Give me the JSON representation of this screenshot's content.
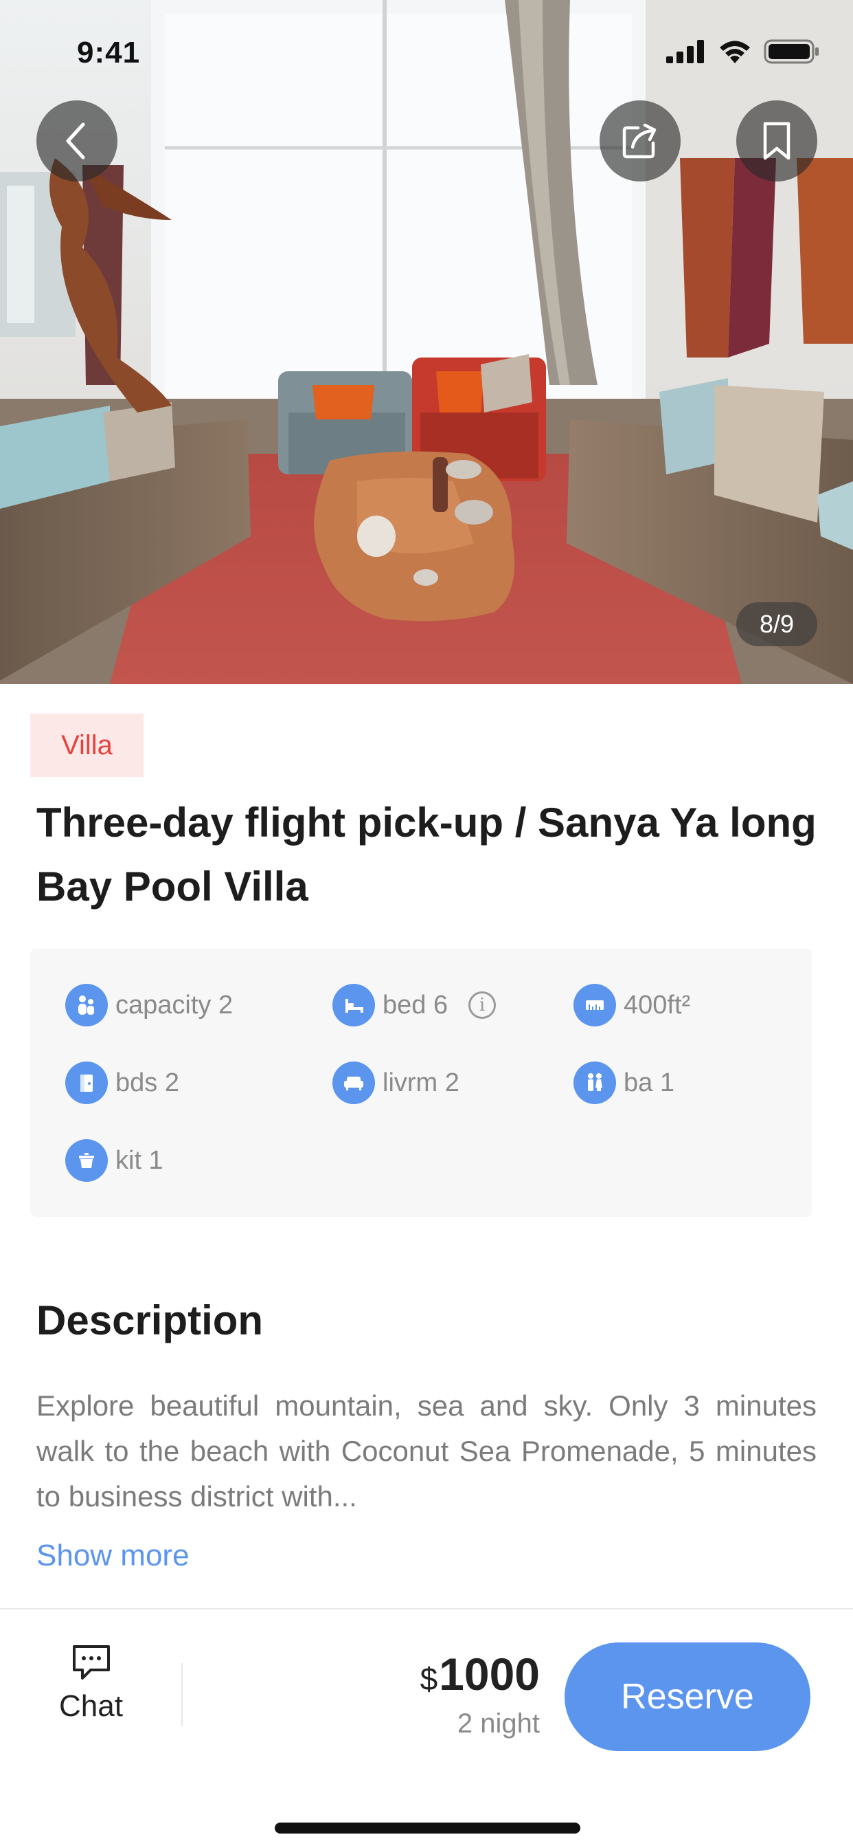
{
  "status_bar": {
    "time": "9:41"
  },
  "hero": {
    "photo_counter": "8/9",
    "icons": {
      "back": "chevron-left-icon",
      "share": "share-icon",
      "bookmark": "bookmark-icon"
    }
  },
  "listing": {
    "tag": "Villa",
    "title": "Three-day flight pick-up / Sanya Ya long Bay Pool Villa",
    "features": [
      {
        "icon": "people-icon",
        "label": "capacity 2"
      },
      {
        "icon": "bed-icon",
        "label": "bed 6"
      },
      {
        "icon": "ruler-icon",
        "label": "400ft²"
      },
      {
        "icon": "door-icon",
        "label": "bds 2"
      },
      {
        "icon": "sofa-icon",
        "label": "livrm 2"
      },
      {
        "icon": "restroom-icon",
        "label": "ba 1"
      },
      {
        "icon": "pot-icon",
        "label": "kit 1"
      }
    ],
    "info_icon": "info-icon"
  },
  "description": {
    "heading": "Description",
    "text": "Explore beautiful mountain, sea and sky. Only 3 minutes walk to the beach with Coconut Sea Promenade, 5 minutes to business district with...",
    "show_more": "Show more"
  },
  "bottom_bar": {
    "chat_label": "Chat",
    "price_currency": "$",
    "price_value": "1000",
    "nights": "2 night",
    "reserve_label": "Reserve"
  },
  "colors": {
    "accent": "#5b95ee",
    "tag_text": "#e8413c",
    "tag_bg": "#fde8e8"
  }
}
